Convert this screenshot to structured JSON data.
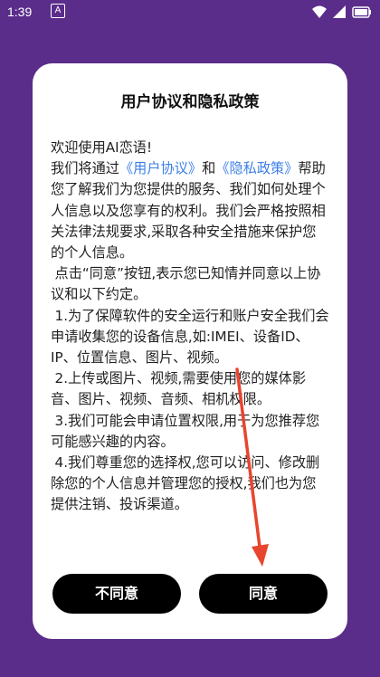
{
  "status_bar": {
    "time": "1:39",
    "notification_letter": "A"
  },
  "dialog": {
    "title": "用户协议和隐私政策",
    "paragraphs": {
      "greeting": "欢迎使用AI恋语!",
      "intro_prefix": "我们将通过",
      "user_agreement_link": "《用户协议》",
      "intro_and": "和",
      "privacy_policy_link": "《隐私政策》",
      "intro_suffix": "帮助您了解我们为您提供的服务、我们如何处理个人信息以及您享有的权利。我们会严格按照相关法律法规要求,采取各种安全措施来保护您的个人信息。",
      "consent_note": "点击“同意”按钮,表示您已知情并同意以上协议和以下约定。",
      "item_1": "1.为了保障软件的安全运行和账户安全我们会申请收集您的设备信息,如:IMEI、设备ID、IP、位置信息、图片、视频。",
      "item_2": "2.上传或图片、视频,需要使用您的媒体影音、图片、视频、音频、相机权限。",
      "item_3": "3.我们可能会申请位置权限,用于为您推荐您可能感兴趣的内容。",
      "item_4": "4.我们尊重您的选择权,您可以访问、修改删除您的个人信息并管理您的授权,我们也为您提供注销、投诉渠道。"
    },
    "buttons": {
      "disagree": "不同意",
      "agree": "同意"
    }
  },
  "colors": {
    "background": "#5b2d8a",
    "link": "#3d7fe6",
    "button": "#000000",
    "annotation_arrow": "#e8452f"
  }
}
